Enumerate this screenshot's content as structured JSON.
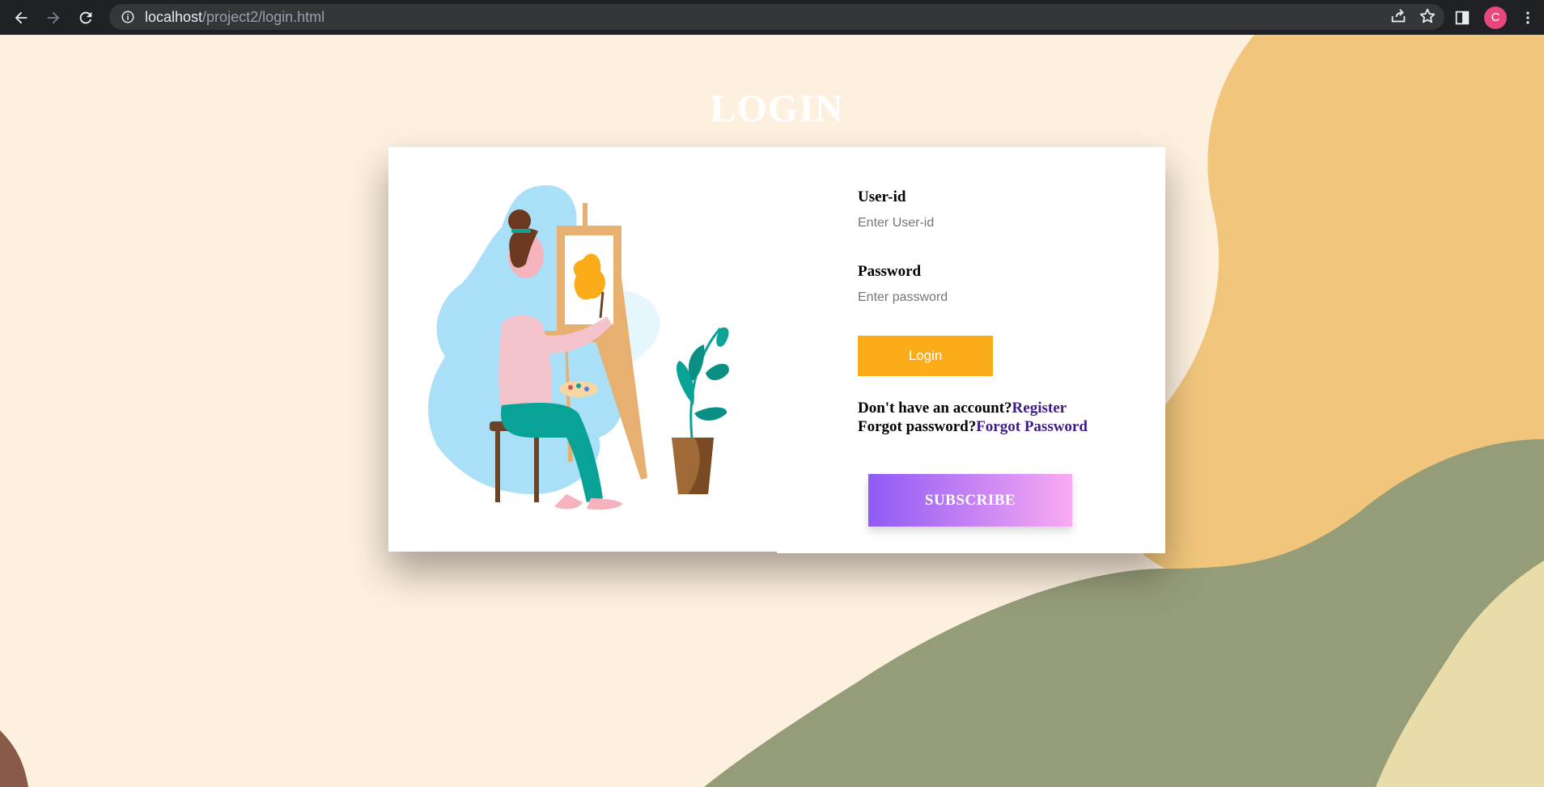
{
  "browser": {
    "url_host": "localhost",
    "url_path": "/project2/login.html",
    "avatar_letter": "C"
  },
  "page": {
    "title": "LOGIN"
  },
  "form": {
    "userid_label": "User-id",
    "userid_placeholder": "Enter User-id",
    "password_label": "Password",
    "password_placeholder": "Enter password",
    "login_label": "Login",
    "no_account_text": "Don't have an account?",
    "register_link": "Register",
    "forgot_text": "Forgot password?",
    "forgot_link": "Forgot Password",
    "subscribe_label": "SUBSCRIBE"
  },
  "colors": {
    "page_bg": "#fef0df",
    "blob_orange": "#f1c67c",
    "blob_green": "#959c78",
    "blob_cream": "#e8dca9",
    "login_button": "#fdac19",
    "link": "#3d1b8c",
    "subscribe_gradient_start": "#8f5af5",
    "subscribe_gradient_end": "#f9abf2",
    "avatar": "#e8477d"
  },
  "icons": [
    "back-icon",
    "forward-icon",
    "reload-icon",
    "info-icon",
    "share-icon",
    "star-icon",
    "side-panel-icon",
    "kebab-menu-icon"
  ]
}
